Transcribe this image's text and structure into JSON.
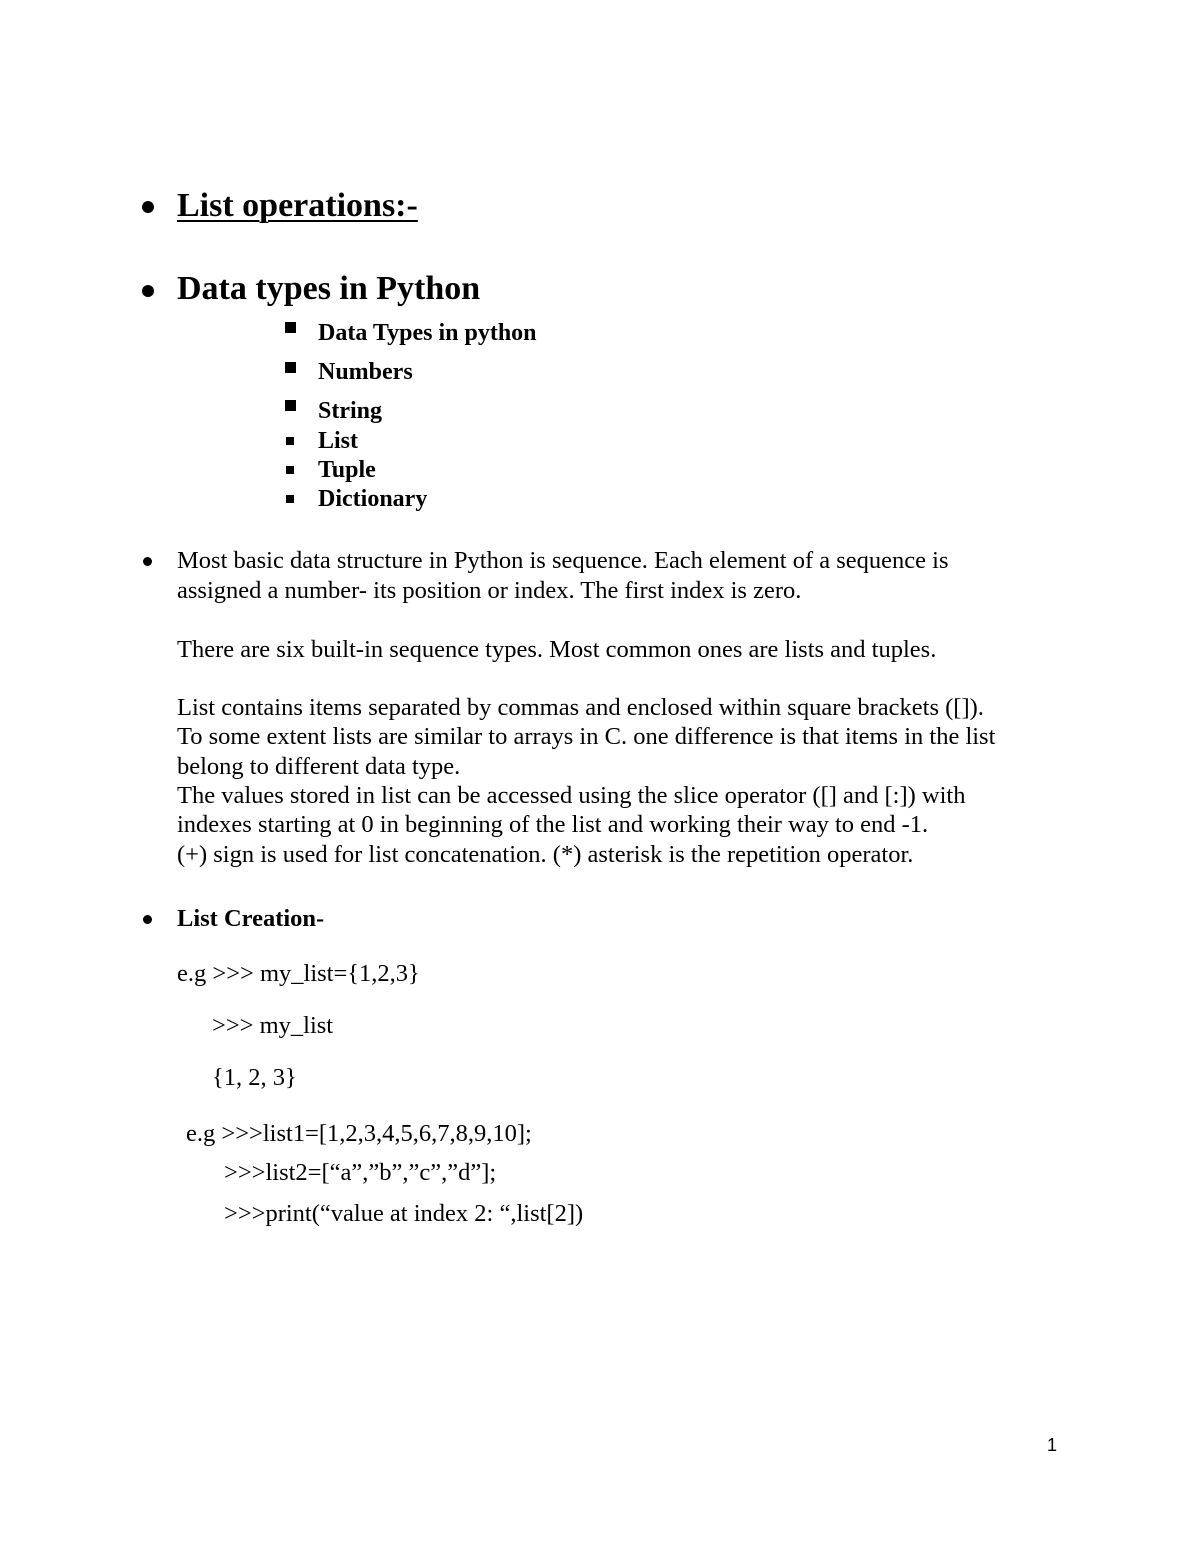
{
  "headings": {
    "list_operations": "List operations:- ",
    "data_types": "Data types in Python"
  },
  "subitems": [
    "Data Types in python",
    "Numbers",
    "String",
    "List",
    "Tuple",
    "Dictionary"
  ],
  "paragraphs": {
    "p1_line1": "Most basic data structure in Python is sequence. Each element of a sequence is",
    "p1_line2": "assigned  a number- its position or index. The first index is zero.",
    "p2": "There are six built-in sequence types. Most common ones are lists and tuples.",
    "p3_lines": [
      "List contains items separated by commas and enclosed within square brackets ([]).",
      "To some extent lists are similar to arrays in C. one difference is that items in the list",
      "belong to different data type.",
      "The values stored in list can be accessed using the slice operator ([] and [:]) with",
      "indexes starting at 0 in beginning of the list and working their way to end -1.",
      "(+) sign is used for list concatenation. (*) asterisk is the repetition operator."
    ]
  },
  "list_creation": {
    "heading": "List Creation-",
    "example1": [
      "e.g >>> my_list={1,2,3}",
      ">>> my_list",
      "{1, 2, 3}"
    ],
    "example2": [
      "e.g >>>list1=[1,2,3,4,5,6,7,8,9,10];",
      ">>>list2=[“a”,”b”,”c”,”d”];",
      ">>>print(“value at index 2: “,list[2])"
    ]
  },
  "page_number": "1"
}
